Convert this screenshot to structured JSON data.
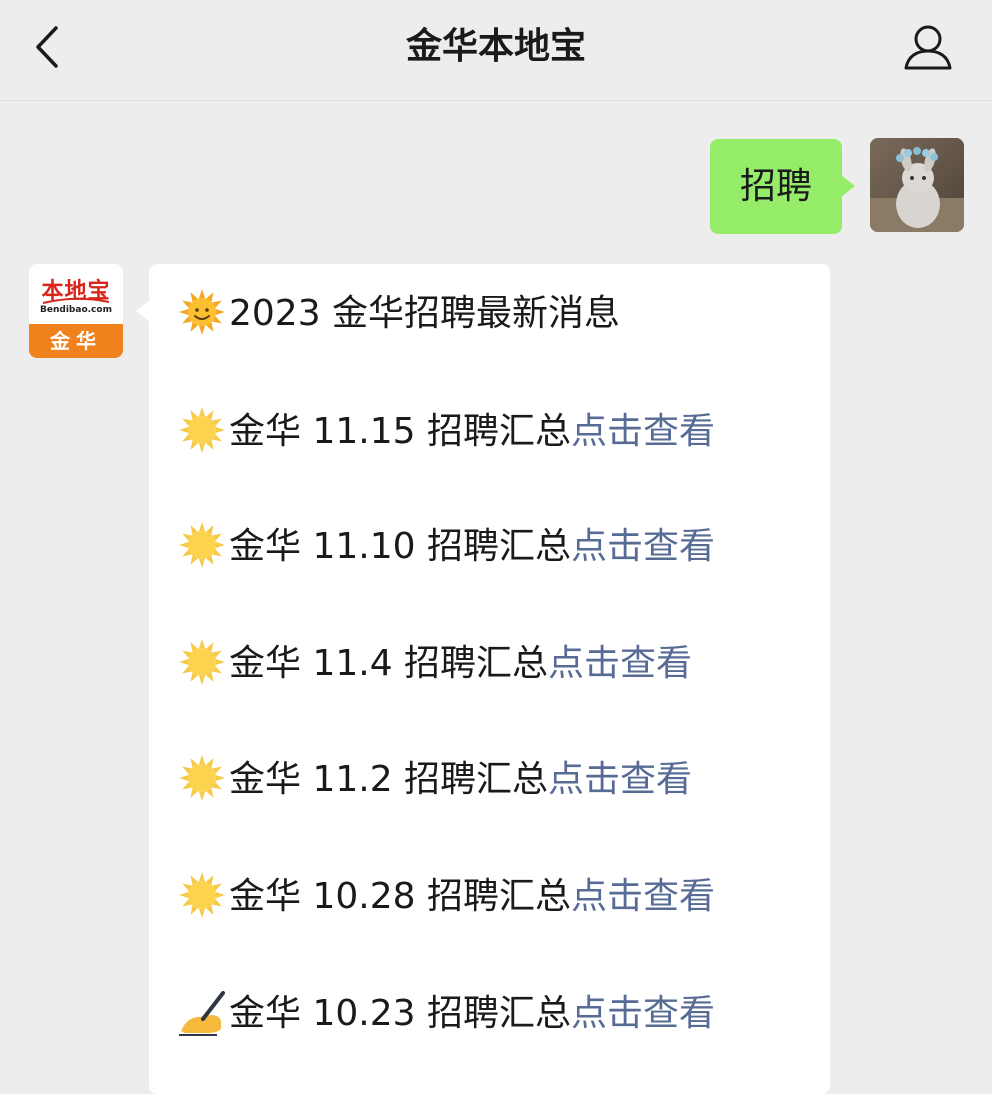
{
  "header": {
    "title": "金华本地宝"
  },
  "outgoing_message": {
    "text": "招聘"
  },
  "incoming_avatar": {
    "logo_main": "本地宝",
    "logo_url": "Bendibao.com",
    "logo_city": "金华"
  },
  "incoming_message": {
    "lines": [
      {
        "icon": "sun-face-icon",
        "text": "2023 金华招聘最新消息",
        "link": ""
      },
      {
        "icon": "sun-icon",
        "text": "金华 11.15 招聘汇总",
        "link": "点击查看"
      },
      {
        "icon": "sun-icon",
        "text": "金华 11.10 招聘汇总",
        "link": "点击查看"
      },
      {
        "icon": "sun-icon",
        "text": "金华 11.4 招聘汇总",
        "link": "点击查看"
      },
      {
        "icon": "sun-icon",
        "text": "金华 11.2 招聘汇总",
        "link": "点击查看"
      },
      {
        "icon": "sun-icon",
        "text": "金华 10.28 招聘汇总",
        "link": "点击查看"
      },
      {
        "icon": "writing-hand-icon",
        "text": "金华 10.23 招聘汇总",
        "link": "点击查看"
      }
    ]
  },
  "colors": {
    "background": "#ededed",
    "outgoing_bubble": "#95ec69",
    "incoming_bubble": "#ffffff",
    "link": "#576b95",
    "logo_red": "#d8261b",
    "logo_orange": "#f0821e"
  }
}
